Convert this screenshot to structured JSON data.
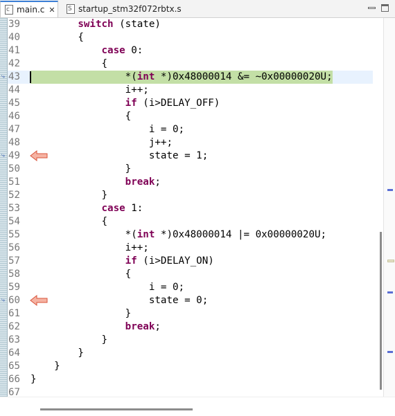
{
  "tabs": [
    {
      "label": "main.c",
      "active": true,
      "icon": "c-source-file-icon",
      "icon_text": "c"
    },
    {
      "label": "startup_stm32f072rbtx.s",
      "active": false,
      "icon": "assembly-file-icon",
      "icon_text": "S"
    }
  ],
  "close_glyph": "✕",
  "lines": [
    {
      "no": "39",
      "code": [
        [
          "        ",
          ""
        ],
        [
          "switch",
          "kw"
        ],
        [
          " (state)",
          ""
        ]
      ]
    },
    {
      "no": "40",
      "code": [
        [
          "        {",
          ""
        ]
      ]
    },
    {
      "no": "41",
      "code": [
        [
          "            ",
          ""
        ],
        [
          "case",
          "kw"
        ],
        [
          " 0:",
          ""
        ]
      ]
    },
    {
      "no": "42",
      "code": [
        [
          "            {",
          ""
        ]
      ]
    },
    {
      "no": "43",
      "current": true,
      "code": [
        [
          "                *(",
          ""
        ],
        [
          "int",
          "kw"
        ],
        [
          " *)0x48000014 &= ~0x00000020U;",
          ""
        ]
      ]
    },
    {
      "no": "44",
      "code": [
        [
          "                i++;",
          ""
        ]
      ]
    },
    {
      "no": "45",
      "code": [
        [
          "                ",
          ""
        ],
        [
          "if",
          "kw"
        ],
        [
          " (i>DELAY_OFF)",
          ""
        ]
      ]
    },
    {
      "no": "46",
      "code": [
        [
          "                {",
          ""
        ]
      ]
    },
    {
      "no": "47",
      "code": [
        [
          "                    i = 0;",
          ""
        ]
      ]
    },
    {
      "no": "48",
      "code": [
        [
          "                    j++;",
          ""
        ]
      ]
    },
    {
      "no": "49",
      "breakpoint": true,
      "code": [
        [
          "                    state = 1;",
          ""
        ]
      ]
    },
    {
      "no": "50",
      "code": [
        [
          "                }",
          ""
        ]
      ]
    },
    {
      "no": "51",
      "code": [
        [
          "                ",
          ""
        ],
        [
          "break",
          "kw"
        ],
        [
          ";",
          ""
        ]
      ]
    },
    {
      "no": "52",
      "code": [
        [
          "            }",
          ""
        ]
      ]
    },
    {
      "no": "53",
      "code": [
        [
          "            ",
          ""
        ],
        [
          "case",
          "kw"
        ],
        [
          " 1:",
          ""
        ]
      ]
    },
    {
      "no": "54",
      "code": [
        [
          "            {",
          ""
        ]
      ]
    },
    {
      "no": "55",
      "code": [
        [
          "                *(",
          ""
        ],
        [
          "int",
          "kw"
        ],
        [
          " *)0x48000014 |= 0x00000020U;",
          ""
        ]
      ]
    },
    {
      "no": "56",
      "code": [
        [
          "                i++;",
          ""
        ]
      ]
    },
    {
      "no": "57",
      "code": [
        [
          "                ",
          ""
        ],
        [
          "if",
          "kw"
        ],
        [
          " (i>DELAY_ON)",
          ""
        ]
      ]
    },
    {
      "no": "58",
      "code": [
        [
          "                {",
          ""
        ]
      ]
    },
    {
      "no": "59",
      "code": [
        [
          "                    i = 0;",
          ""
        ]
      ]
    },
    {
      "no": "60",
      "breakpoint": true,
      "code": [
        [
          "                    state = 0;",
          ""
        ]
      ]
    },
    {
      "no": "61",
      "code": [
        [
          "                }",
          ""
        ]
      ]
    },
    {
      "no": "62",
      "code": [
        [
          "                ",
          ""
        ],
        [
          "break",
          "kw"
        ],
        [
          ";",
          ""
        ]
      ]
    },
    {
      "no": "63",
      "code": [
        [
          "            }",
          ""
        ]
      ]
    },
    {
      "no": "64",
      "code": [
        [
          "        }",
          ""
        ]
      ]
    },
    {
      "no": "65",
      "code": [
        [
          "    }",
          ""
        ]
      ]
    },
    {
      "no": "66",
      "code": [
        [
          "}",
          ""
        ]
      ]
    },
    {
      "no": "67",
      "code": [
        [
          "",
          ""
        ]
      ]
    }
  ],
  "colors": {
    "keyword": "#7f0055",
    "current_line_highlight": "#c3dfa6",
    "breakpoint_arrow_fill": "#f5b3a3",
    "breakpoint_arrow_stroke": "#d9533a",
    "overview_mark": "#5a6ed4"
  }
}
